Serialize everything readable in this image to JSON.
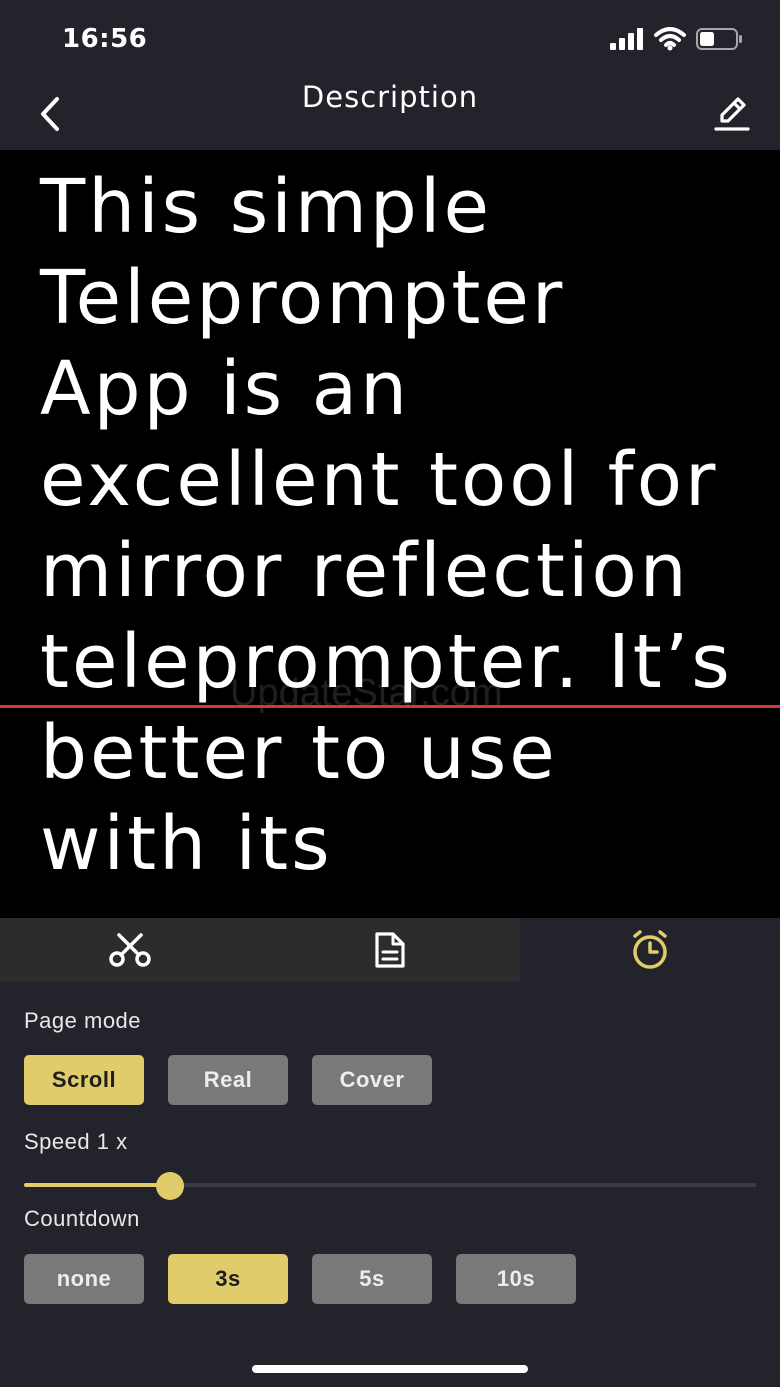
{
  "status_bar": {
    "time": "16:56"
  },
  "nav": {
    "title": "Description"
  },
  "prompter": {
    "text": "This simple Teleprompter App is an excellent tool for mirror reflection teleprompter. It’s better to use with its",
    "watermark": "UpdateStar.com"
  },
  "tabs": [
    {
      "icon": "scissors-icon",
      "active": false
    },
    {
      "icon": "document-icon",
      "active": false
    },
    {
      "icon": "clock-icon",
      "active": true
    }
  ],
  "page_mode": {
    "label": "Page mode",
    "options": [
      "Scroll",
      "Real",
      "Cover"
    ],
    "selected": "Scroll"
  },
  "speed": {
    "label": "Speed 1 x",
    "value_fraction": 0.2
  },
  "countdown": {
    "label": "Countdown",
    "options": [
      "none",
      "3s",
      "5s",
      "10s"
    ],
    "selected": "3s"
  },
  "colors": {
    "accent": "#e1cc6c",
    "guide_line": "#d9362f",
    "background": "#23232b",
    "prompter_bg": "#000000"
  }
}
